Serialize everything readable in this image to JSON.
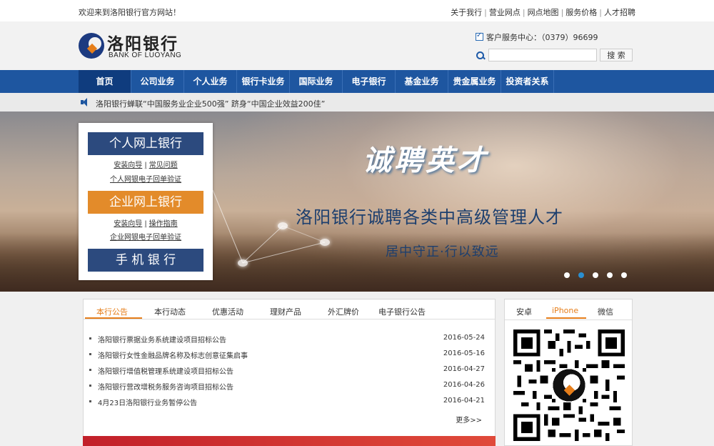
{
  "topbar": {
    "welcome": "欢迎来到洛阳银行官方网站！",
    "links": [
      "关于我行",
      "营业网点",
      "网点地图",
      "服务价格",
      "人才招聘"
    ]
  },
  "header": {
    "logo_cn": "洛阳银行",
    "logo_en": "BANK OF LUOYANG",
    "service_label": "客户服务中心：（0379）96699",
    "search_placeholder": "",
    "search_button": "搜 索"
  },
  "nav": {
    "items": [
      {
        "label": "首页",
        "active": true
      },
      {
        "label": "公司业务",
        "active": false
      },
      {
        "label": "个人业务",
        "active": false
      },
      {
        "label": "银行卡业务",
        "active": false
      },
      {
        "label": "国际业务",
        "active": false
      },
      {
        "label": "电子银行",
        "active": false
      },
      {
        "label": "基金业务",
        "active": false
      },
      {
        "label": "贵金属业务",
        "active": false
      },
      {
        "label": "投资者关系",
        "active": false
      }
    ]
  },
  "notice": {
    "text": "洛阳银行蝉联“中国服务业企业500强” 跻身“中国企业效益200佳”"
  },
  "banner": {
    "slogan_title": "诚聘英才",
    "slogan_main": "洛阳银行诚聘各类中高级管理人才",
    "slogan_sub": "居中守正·行以致远",
    "active_dot": 1,
    "dot_count": 5
  },
  "login": {
    "personal": "个人网上银行",
    "personal_links": [
      "安装向导",
      "常见问题"
    ],
    "personal_verify": "个人网银电子回单验证",
    "corporate": "企业网上银行",
    "corporate_links": [
      "安装向导",
      "操作指南"
    ],
    "corporate_verify": "企业网银电子回单验证",
    "mobile": "手 机 银 行"
  },
  "news": {
    "tabs": [
      "本行公告",
      "本行动态",
      "优惠活动",
      "理财产品",
      "外汇牌价",
      "电子银行公告"
    ],
    "active_tab": 0,
    "items": [
      {
        "title": "洛阳银行票据业务系统建设项目招标公告",
        "date": "2016-05-24"
      },
      {
        "title": "洛阳银行女性金融品牌名称及标志创意征集启事",
        "date": "2016-05-16"
      },
      {
        "title": "洛阳银行增值税管理系统建设项目招标公告",
        "date": "2016-04-27"
      },
      {
        "title": "洛阳银行营改增税务服务咨询项目招标公告",
        "date": "2016-04-26"
      },
      {
        "title": "4月23日洛阳银行业务暂停公告",
        "date": "2016-04-21"
      }
    ],
    "more": "更多>>"
  },
  "app": {
    "tabs": [
      "安卓",
      "iPhone",
      "微信"
    ],
    "active_tab": 1
  },
  "colors": {
    "nav_blue": "#1e56a0",
    "accent_orange": "#e67e1a",
    "login_blue": "#2c4a7e",
    "login_orange": "#e38b2a"
  }
}
